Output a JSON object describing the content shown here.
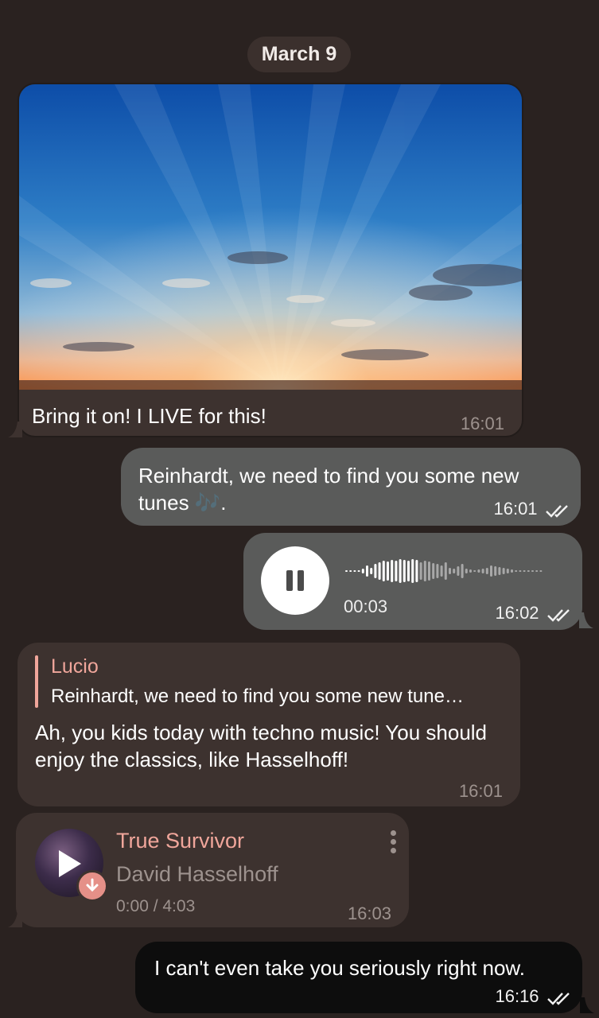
{
  "date": "March 9",
  "messages": {
    "photo": {
      "caption": "Bring it on! I LIVE for this!",
      "time": "16:01"
    },
    "reinhardt": {
      "text": "Reinhardt, we need to find you some new tunes 🎶.",
      "time": "16:01"
    },
    "voice": {
      "duration": "00:03",
      "time": "16:02",
      "state": "playing"
    },
    "reply": {
      "name": "Lucio",
      "quote": "Reinhardt, we need to find you some new tune…",
      "text": "Ah, you kids today with techno music! You should enjoy the classics, like Hasselhoff!",
      "time": "16:01"
    },
    "audio": {
      "title": "True Survivor",
      "artist": "David Hasselhoff",
      "progress": "0:00 / 4:03",
      "time": "16:03"
    },
    "last": {
      "text": "I can't even take you seriously right now.",
      "time": "16:16"
    }
  },
  "colors": {
    "background": "#2a2220",
    "incoming_bubble": "#3d322f",
    "outgoing_bubble": "#5a5b5a",
    "accent": "#f0a69b"
  },
  "icons": [
    "pause-icon",
    "play-icon",
    "download-icon",
    "double-check-icon",
    "more-vert-icon"
  ]
}
